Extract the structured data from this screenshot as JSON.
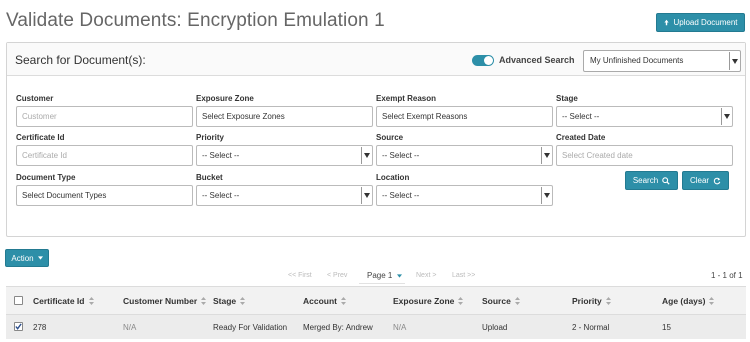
{
  "page": {
    "title": "Validate Documents: Encryption Emulation 1",
    "upload_label": "Upload Document"
  },
  "search_panel": {
    "title": "Search for Document(s):",
    "advanced_label": "Advanced Search",
    "advanced_enabled": true,
    "saved_search": "My Unfinished Documents",
    "fields": {
      "customer": {
        "label": "Customer",
        "placeholder": "Customer"
      },
      "exposure_zone": {
        "label": "Exposure Zone",
        "value": "Select Exposure Zones"
      },
      "exempt_reason": {
        "label": "Exempt Reason",
        "value": "Select Exempt Reasons"
      },
      "stage": {
        "label": "Stage",
        "value": "-- Select --"
      },
      "certificate_id": {
        "label": "Certificate Id",
        "placeholder": "Certificate Id"
      },
      "priority": {
        "label": "Priority",
        "value": "-- Select --"
      },
      "source": {
        "label": "Source",
        "value": "-- Select --"
      },
      "created_date": {
        "label": "Created Date",
        "placeholder": "Select Created date"
      },
      "document_type": {
        "label": "Document Type",
        "value": "Select Document Types"
      },
      "bucket": {
        "label": "Bucket",
        "value": "-- Select --"
      },
      "location": {
        "label": "Location",
        "value": "-- Select --"
      }
    },
    "search_label": "Search",
    "clear_label": "Clear"
  },
  "action_label": "Action",
  "pagination": {
    "first": "<< First",
    "prev": "< Prev",
    "current": "Page 1",
    "next": "Next >",
    "last": "Last >>",
    "range": "1 - 1 of 1"
  },
  "table": {
    "headers": {
      "certificate_id": "Certificate Id",
      "customer_number": "Customer Number",
      "stage": "Stage",
      "account": "Account",
      "exposure_zone": "Exposure Zone",
      "source": "Source",
      "priority": "Priority",
      "age": "Age (days)"
    },
    "rows": [
      {
        "checked": true,
        "certificate_id": "278",
        "customer_number": "N/A",
        "stage": "Ready For Validation",
        "account": "Merged By: Andrew",
        "exposure_zone": "N/A",
        "source": "Upload",
        "priority": "2 - Normal",
        "age": "15"
      }
    ]
  },
  "colors": {
    "accent": "#2d8fa8",
    "title": "#666666"
  }
}
